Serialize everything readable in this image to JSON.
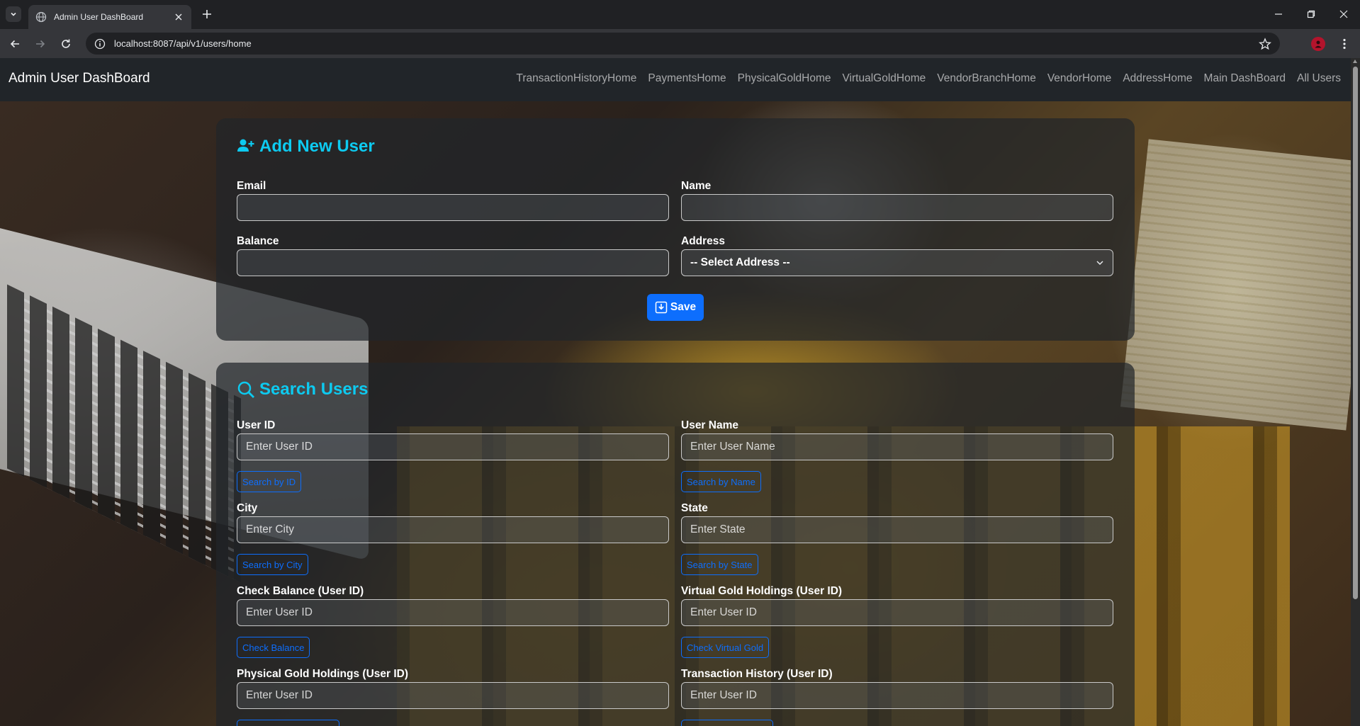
{
  "browser": {
    "tab_title": "Admin User DashBoard",
    "url": "localhost:8087/api/v1/users/home"
  },
  "navbar": {
    "brand": "Admin User DashBoard",
    "links": [
      "TransactionHistoryHome",
      "PaymentsHome",
      "PhysicalGoldHome",
      "VirtualGoldHome",
      "VendorBranchHome",
      "VendorHome",
      "AddressHome",
      "Main DashBoard",
      "All Users"
    ]
  },
  "add_user": {
    "title": "Add New User",
    "email_label": "Email",
    "name_label": "Name",
    "balance_label": "Balance",
    "address_label": "Address",
    "address_selected": "-- Select Address --",
    "save_label": "Save"
  },
  "search_users": {
    "title": "Search Users",
    "user_id_label": "User ID",
    "user_id_placeholder": "Enter User ID",
    "search_by_id": "Search by ID",
    "user_name_label": "User Name",
    "user_name_placeholder": "Enter User Name",
    "search_by_name": "Search by Name",
    "city_label": "City",
    "city_placeholder": "Enter City",
    "search_by_city": "Search by City",
    "state_label": "State",
    "state_placeholder": "Enter State",
    "search_by_state": "Search by State",
    "check_balance_label": "Check Balance (User ID)",
    "check_balance_placeholder": "Enter User ID",
    "check_balance_button": "Check Balance",
    "virtual_gold_label": "Virtual Gold Holdings (User ID)",
    "virtual_gold_placeholder": "Enter User ID",
    "virtual_gold_button": "Check Virtual Gold",
    "physical_gold_label": "Physical Gold Holdings (User ID)",
    "physical_gold_placeholder": "Enter User ID",
    "transaction_history_label": "Transaction History (User ID)",
    "transaction_history_placeholder": "Enter User ID"
  },
  "colors": {
    "accent_title": "#0dcaf0",
    "primary": "#0d6efd",
    "navbar_bg": "#212529"
  }
}
